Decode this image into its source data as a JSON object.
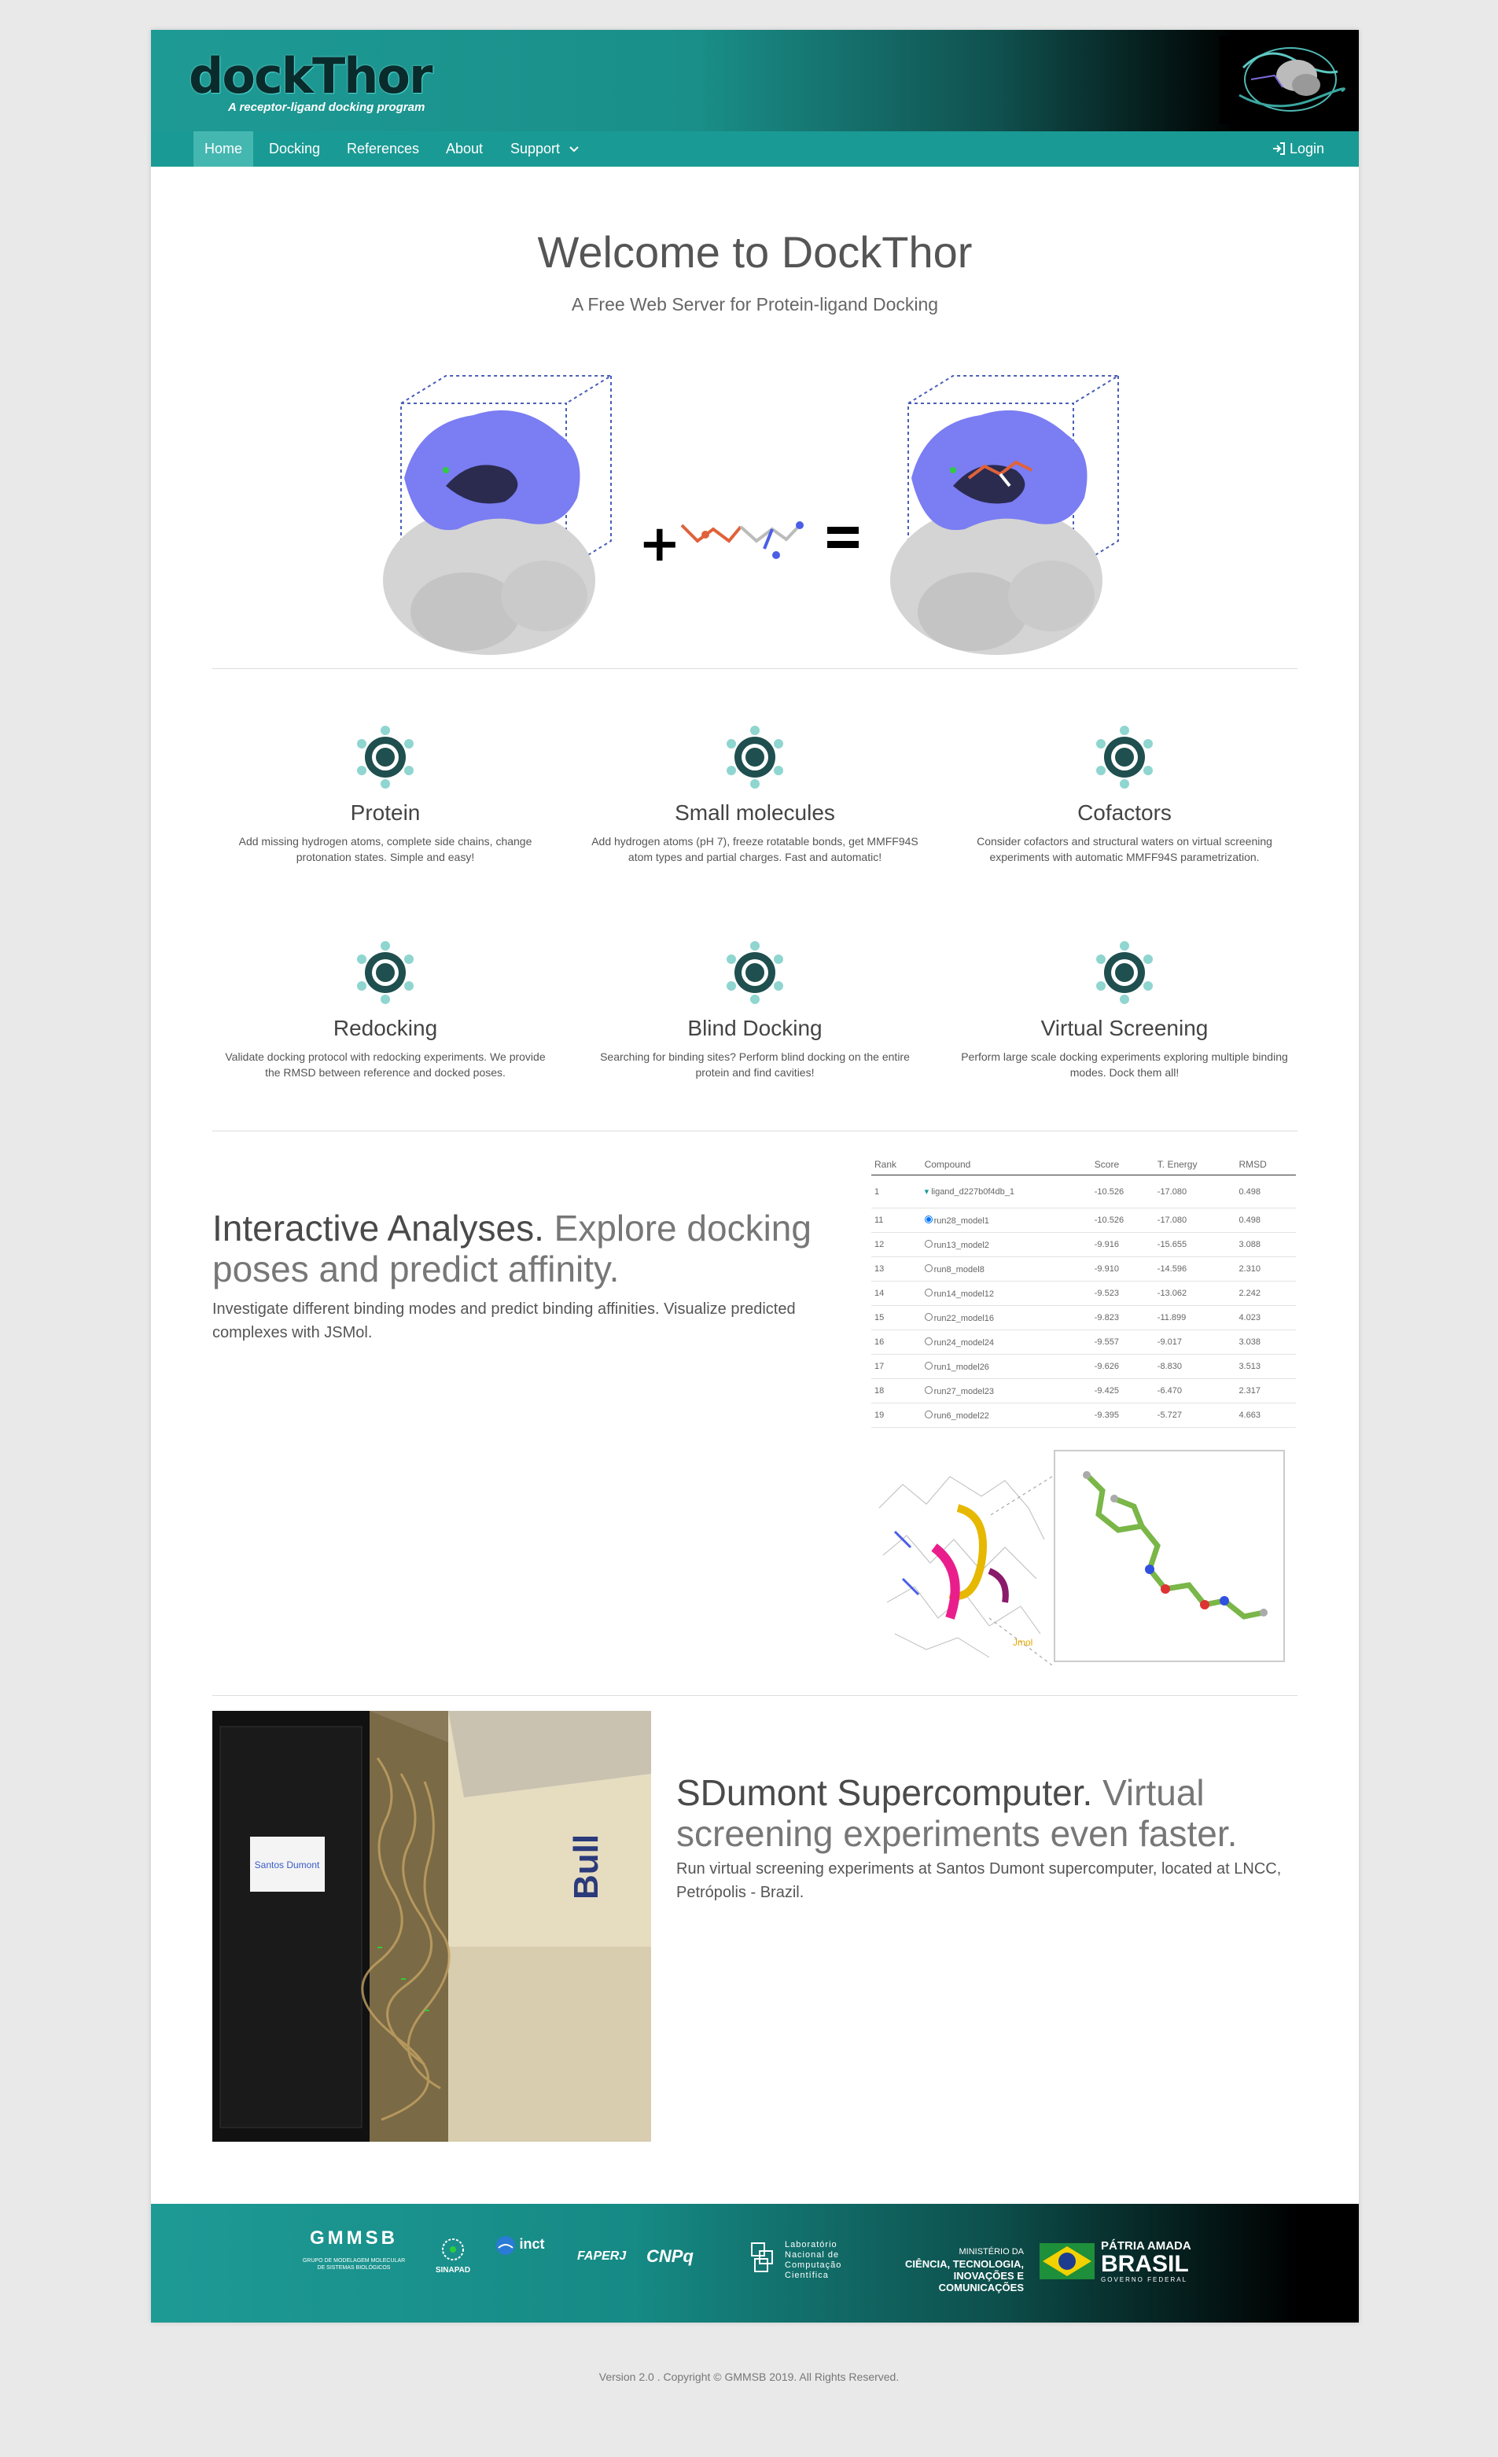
{
  "header": {
    "logo_text": "dockThor",
    "logo_subtitle": "A receptor-ligand docking program"
  },
  "nav": {
    "items": [
      {
        "label": "Home",
        "active": true
      },
      {
        "label": "Docking"
      },
      {
        "label": "References"
      },
      {
        "label": "About"
      },
      {
        "label": "Support"
      }
    ],
    "login": "Login"
  },
  "hero": {
    "title": "Welcome to DockThor",
    "subtitle": "A Free Web Server for Protein-ligand Docking",
    "plus_symbol": "+",
    "equals_symbol": "="
  },
  "features": [
    {
      "title": "Protein",
      "desc": "Add missing hydrogen atoms, complete side chains, change protonation states. Simple and easy!"
    },
    {
      "title": "Small molecules",
      "desc": "Add hydrogen atoms (pH 7), freeze rotatable bonds, get MMFF94S atom types and partial charges. Fast and automatic!"
    },
    {
      "title": "Cofactors",
      "desc": "Consider cofactors and structural waters on virtual screening experiments with automatic MMFF94S parametrization."
    },
    {
      "title": "Redocking",
      "desc": "Validate docking protocol with redocking experiments. We provide the RMSD between reference and docked poses."
    },
    {
      "title": "Blind Docking",
      "desc": "Searching for binding sites? Perform blind docking on the entire protein and find cavities!"
    },
    {
      "title": "Virtual Screening",
      "desc": "Perform large scale docking experiments exploring multiple binding modes. Dock them all!"
    }
  ],
  "interactive": {
    "heading_strong": "Interactive Analyses.",
    "heading_muted": "Explore docking poses and predict affinity.",
    "text": "Investigate different binding modes and predict binding affinities. Visualize predicted complexes with JSMol.",
    "table": {
      "headers": [
        "Rank",
        "Compound",
        "Score",
        "T. Energy",
        "RMSD"
      ],
      "rows": [
        [
          "1",
          "ligand_d227b0f4db_1",
          "-10.526",
          "-17.080",
          "0.498"
        ],
        [
          "11",
          "run28_model1",
          "-10.526",
          "-17.080",
          "0.498"
        ],
        [
          "12",
          "run13_model2",
          "-9.916",
          "-15.655",
          "3.088"
        ],
        [
          "13",
          "run8_model8",
          "-9.910",
          "-14.596",
          "2.310"
        ],
        [
          "14",
          "run14_model12",
          "-9.523",
          "-13.062",
          "2.242"
        ],
        [
          "15",
          "run22_model16",
          "-9.823",
          "-11.899",
          "4.023"
        ],
        [
          "16",
          "run24_model24",
          "-9.557",
          "-9.017",
          "3.038"
        ],
        [
          "17",
          "run1_model26",
          "-9.626",
          "-8.830",
          "3.513"
        ],
        [
          "18",
          "run27_model23",
          "-9.425",
          "-6.470",
          "2.317"
        ],
        [
          "19",
          "run6_model22",
          "-9.395",
          "-5.727",
          "4.663"
        ]
      ]
    },
    "jsmol_label": "Jmol"
  },
  "supercomputer": {
    "heading_strong": "SDumont Supercomputer.",
    "heading_muted": "Virtual screening experiments even faster.",
    "text": "Run virtual screening experiments at Santos Dumont supercomputer, located at LNCC, Petrópolis - Brazil.",
    "photo_sign": "Santos Dumont",
    "photo_brand": "Bull"
  },
  "footer_logos": {
    "gmmsb": "GMMSB",
    "gmmsb_sub": "GRUPO DE MODELAGEM MOLECULAR DE SISTEMAS BIOLÓGICOS",
    "sinapad": "SINAPAD",
    "inct": "inct",
    "faperj": "FAPERJ",
    "cnpq": "CNPq",
    "lncc": "Laboratório Nacional de Computação Científica",
    "ministerio_line1": "MINISTÉRIO DA",
    "ministerio_line2": "CIÊNCIA, TECNOLOGIA,",
    "ministerio_line3": "INOVAÇÕES E COMUNICAÇÕES",
    "patria": "PÁTRIA AMADA",
    "brasil": "BRASIL",
    "governo": "GOVERNO FEDERAL"
  },
  "copyright": "Version 2.0 . Copyright © GMMSB 2019. All Rights Reserved.",
  "colors": {
    "teal": "#1a9a94",
    "active_nav": "#45b7b1",
    "protein_blue": "#7b7df2"
  }
}
